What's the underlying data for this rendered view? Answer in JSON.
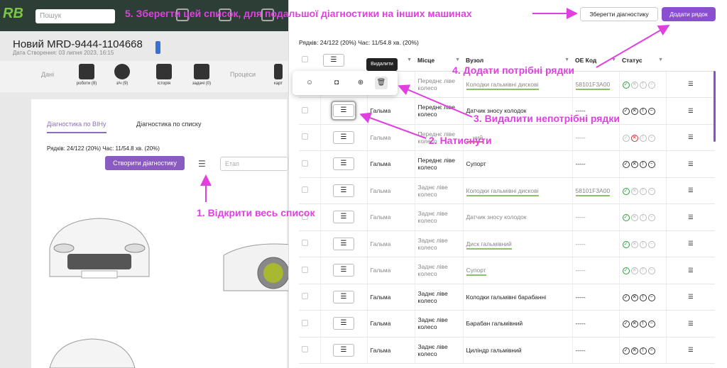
{
  "app": {
    "logo": "RB",
    "search_placeholder": "Пошук"
  },
  "car": {
    "title": "Новий MRD-9444-1104668",
    "created": "Дата Створення: 03 липня 2023, 16:15"
  },
  "nav": {
    "left_text": "Дані",
    "items": [
      {
        "label": "роботи (8)",
        "icon": "wrench-icon"
      },
      {
        "label": "з/ч (9)",
        "icon": "brake-disc-icon"
      },
      {
        "label": "історія",
        "icon": "history-icon"
      },
      {
        "label": "задачі (0)",
        "icon": "tasks-icon"
      }
    ],
    "right_text": "Процеси",
    "cut_label": "карт"
  },
  "left_panel": {
    "tabs": [
      "Діагностика по ВІНу",
      "Діагностика по списку"
    ],
    "rows_info": "Рядків: 24/122 (20%) Час: 11/54.8 хв. (20%)",
    "create_button": "Створити діагностику",
    "etap_placeholder": "Етап"
  },
  "right_panel": {
    "rows_info": "Рядків: 24/122 (20%) Час: 11/54.8 хв. (20%)",
    "save_button": "Зберегти діагностику",
    "add_button": "Додати рядок",
    "columns": [
      "",
      "",
      "",
      "Місце",
      "Вузол",
      "ОЕ Код",
      "Статус",
      ""
    ],
    "rows": [
      {
        "system": "",
        "place": "Переднє ліве колесо",
        "node": "Колодки гальмівні дискові",
        "code": "58101F3A00",
        "dim": true,
        "green": true
      },
      {
        "system": "Гальма",
        "place": "Переднє ліве колесо",
        "node": "Датчик зносу колодок",
        "code": "-----",
        "dim": false,
        "green": false
      },
      {
        "system": "Гальма",
        "place": "Переднє ліве колесо",
        "node": "... ний",
        "code": "-----",
        "dim": true,
        "red": true
      },
      {
        "system": "Гальма",
        "place": "Переднє ліве колесо",
        "node": "Супорт",
        "code": "-----",
        "dim": false
      },
      {
        "system": "Гальма",
        "place": "Заднє ліве колесо",
        "node": "Колодки гальмівні дискові",
        "code": "58101F3A00",
        "dim": true,
        "green": true
      },
      {
        "system": "Гальма",
        "place": "Заднє ліве колесо",
        "node": "Датчик зносу колодок",
        "code": "-----",
        "dim": true
      },
      {
        "system": "Гальма",
        "place": "Заднє ліве колесо",
        "node": "Диск гальмівний",
        "code": "-----",
        "dim": true,
        "green": true
      },
      {
        "system": "Гальма",
        "place": "Заднє ліве колесо",
        "node": "Супорт",
        "code": "-----",
        "dim": true,
        "green": true
      },
      {
        "system": "Гальма",
        "place": "Заднє ліве колесо",
        "node": "Колодки гальмівні барабанні",
        "code": "-----",
        "dim": false
      },
      {
        "system": "Гальма",
        "place": "Заднє ліве колесо",
        "node": "Барабан гальмівний",
        "code": "-----",
        "dim": false
      },
      {
        "system": "Гальма",
        "place": "Заднє ліве колесо",
        "node": "Циліндр гальмівний",
        "code": "-----",
        "dim": false
      }
    ]
  },
  "popup": {
    "tooltip": "Видалити"
  },
  "annotations": {
    "a1": "1. Відкрити весь список",
    "a2": "2. Натиснути",
    "a3": "3. Видалити непотрібні рядки",
    "a4": "4. Додати потрібні рядки",
    "a5": "5. Зберегти цей список, для подальшої діагностики на інших машинах"
  },
  "colors": {
    "annotation": "#e040e0",
    "accent": "#8a4fd0",
    "ok": "#2a9d3a",
    "bad": "#cc3333"
  }
}
